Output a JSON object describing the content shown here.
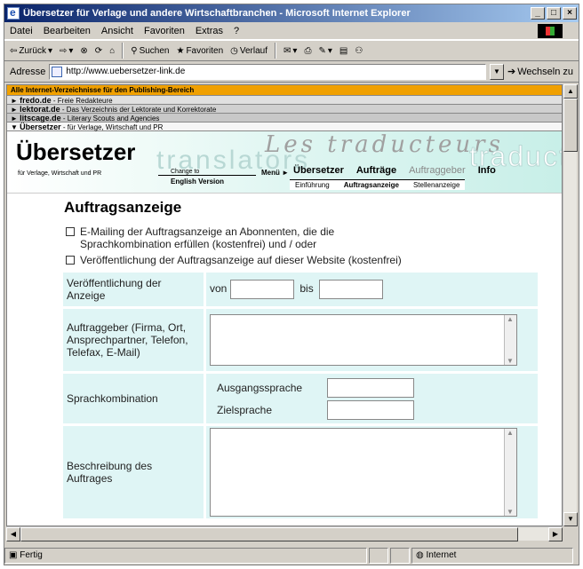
{
  "window": {
    "title": "Übersetzer für Verlage und andere Wirtschaftbranchen - Microsoft Internet Explorer"
  },
  "menubar": [
    "Datei",
    "Bearbeiten",
    "Ansicht",
    "Favoriten",
    "Extras",
    "?"
  ],
  "toolbar": {
    "back": "Zurück",
    "search": "Suchen",
    "favorites": "Favoriten",
    "history": "Verlauf"
  },
  "address": {
    "label": "Adresse",
    "url": "http://www.uebersetzer-link.de",
    "go": "Wechseln zu"
  },
  "portal": {
    "header": "Alle Internet-Verzeichnisse für den Publishing-Bereich",
    "items": [
      {
        "name": "fredo.de",
        "desc": " - Freie Redakteure"
      },
      {
        "name": "lektorat.de",
        "desc": " - Das Verzeichnis der Lektorate und Korrektorate"
      },
      {
        "name": "litscage.de",
        "desc": " - Literary Scouts and Agencies"
      },
      {
        "name": "Übersetzer",
        "desc": " - für Verlage, Wirtschaft und PR"
      }
    ]
  },
  "banner": {
    "brand": "Übersetzer",
    "brand_sub": "für Verlage, Wirtschaft und PR",
    "word_translators": "translators",
    "word_traducteurs": "Les traducteurs",
    "word_traducto": "traducto",
    "change_to": "Change to",
    "english": "English Version",
    "menu": "Menü ►",
    "nav": {
      "uebersetzer": "Übersetzer",
      "auftraege": "Aufträge",
      "auftraggeber": "Auftraggeber",
      "info": "Info"
    },
    "subnav": {
      "einfuehrung": "Einführung",
      "auftragsanzeige": "Auftragsanzeige",
      "stellenanzeige": "Stellenanzeige"
    }
  },
  "form": {
    "heading": "Auftragsanzeige",
    "cb1_line1": "E-Mailing der Auftragsanzeige an Abonnenten, die die",
    "cb1_line2": "Sprachkombination erfüllen (kostenfrei)  und / oder",
    "cb2": "Veröffentlichung der Auftragsanzeige auf dieser Website (kostenfrei)",
    "publication_label": "Veröffentlichung der Anzeige",
    "von": "von",
    "bis": "bis",
    "client_label": "Auftraggeber (Firma, Ort, Ansprechpartner, Telefon, Telefax, E-Mail)",
    "language_label": "Sprachkombination",
    "source_lang": "Ausgangssprache",
    "target_lang": "Zielsprache",
    "description_label": "Beschreibung des Auftrages"
  },
  "status": {
    "text": "Fertig",
    "zone": "Internet"
  }
}
